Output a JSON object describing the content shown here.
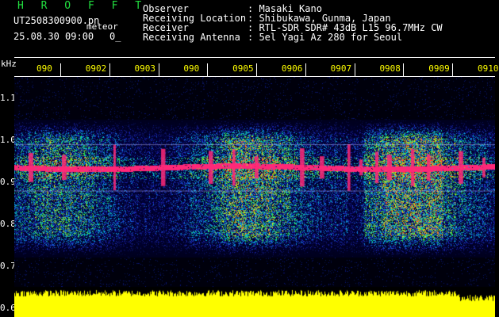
{
  "header": {
    "app_name": "H R O F F T",
    "filename": "UT2508300900.pn",
    "tag": "meteor",
    "datetime": "25.08.30 09:00",
    "counter": "0_"
  },
  "info": [
    {
      "label": "Observer",
      "value": ": Masaki Kano"
    },
    {
      "label": "Receiving Location",
      "value": ": Shibukawa, Gunma, Japan"
    },
    {
      "label": "Receiver",
      "value": ": RTL-SDR SDR# 43dB L15 96.7MHz CW"
    },
    {
      "label": "Receiving Antenna",
      "value": ": 5el Yagi Az 280 for Seoul"
    }
  ],
  "chart_data": {
    "type": "heatmap",
    "ylabel": "kHz",
    "yticks": [
      1.1,
      1.0,
      0.9,
      0.8,
      0.7,
      0.6
    ],
    "ylim": [
      0.58,
      1.15
    ],
    "time_labels": [
      "090",
      "0902",
      "0903",
      "090",
      "0905",
      "0906",
      "0907",
      "0908",
      "0909",
      "0910"
    ],
    "carrier_freq_khz": 0.935,
    "noise_band_khz": [
      0.76,
      1.03
    ],
    "colors": {
      "carrier": "#ff2a7a",
      "noise_low": "#1a2aa0",
      "noise_high": "#ffe000",
      "amplitude": "#ffff00"
    }
  }
}
